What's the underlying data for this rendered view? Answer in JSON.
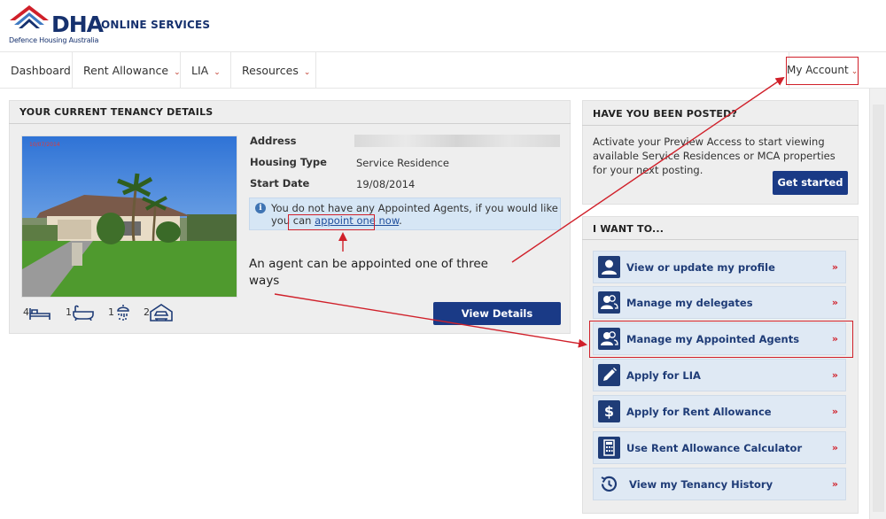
{
  "header": {
    "logo_text": "DHA",
    "logo_subtitle": "Defence Housing Australia",
    "service_title": "ONLINE SERVICES"
  },
  "nav": {
    "items": [
      {
        "label": "Dashboard"
      },
      {
        "label": "Rent Allowance"
      },
      {
        "label": "LIA"
      },
      {
        "label": "Resources"
      }
    ],
    "account_label": "My Account"
  },
  "tenancy": {
    "title": "YOUR CURRENT TENANCY DETAILS",
    "photo_date": "10/07/2014",
    "address_label": "Address",
    "housing_type_label": "Housing Type",
    "housing_type": "Service Residence",
    "start_date_label": "Start Date",
    "start_date": "19/08/2014",
    "amenities": {
      "bedrooms": "4",
      "bathrooms": "1",
      "showers": "1",
      "garages": "2"
    },
    "info_text": "You do not have any Appointed Agents, if you would like you can",
    "info_link": "appoint one now",
    "info_end": ".",
    "view_details": "View Details"
  },
  "annotation": {
    "note": "An agent can be appointed one of three ways",
    "accent_color": "#d0202a"
  },
  "posted": {
    "title": "HAVE YOU BEEN POSTED?",
    "text": "Activate your Preview Access to start viewing available Service Residences or MCA properties for your next posting.",
    "button": "Get started"
  },
  "i_want": {
    "title": "I WANT TO...",
    "arrow": "»",
    "items": [
      {
        "label": "View or update my profile",
        "icon": "user-icon"
      },
      {
        "label": "Manage my delegates",
        "icon": "users-icon"
      },
      {
        "label": "Manage my Appointed Agents",
        "icon": "users-icon"
      },
      {
        "label": "Apply for LIA",
        "icon": "pencil-icon"
      },
      {
        "label": "Apply for Rent Allowance",
        "icon": "dollar-icon"
      },
      {
        "label": "Use Rent Allowance Calculator",
        "icon": "calculator-icon"
      },
      {
        "label": "View my Tenancy History",
        "icon": "history-icon"
      }
    ]
  },
  "colors": {
    "brand_navy": "#1a3a86",
    "panel_bg": "#eeeeee",
    "tile_bg": "#dfe9f4"
  }
}
